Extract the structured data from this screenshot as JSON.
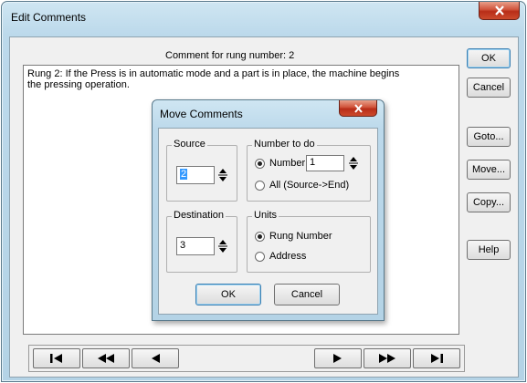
{
  "window": {
    "title": "Edit Comments",
    "rung_label": "Comment for rung number: 2",
    "comment_text": "Rung 2: If the Press is in automatic mode and a part is in place, the machine begins\nthe pressing operation.",
    "buttons": {
      "ok": "OK",
      "cancel": "Cancel",
      "goto": "Goto...",
      "move": "Move...",
      "copy": "Copy...",
      "help": "Help"
    },
    "nav_icons": [
      "first-icon",
      "rewind-icon",
      "previous-icon",
      "next-icon",
      "fast-forward-icon",
      "last-icon"
    ]
  },
  "move_dialog": {
    "title": "Move Comments",
    "source": {
      "label": "Source",
      "value": "2"
    },
    "number_to_do": {
      "label": "Number to do",
      "number_option": "Number",
      "number_value": "1",
      "all_option": "All (Source->End)",
      "selected": "number"
    },
    "destination": {
      "label": "Destination",
      "value": "3"
    },
    "units": {
      "label": "Units",
      "rung_option": "Rung Number",
      "address_option": "Address",
      "selected": "rung"
    },
    "ok": "OK",
    "cancel": "Cancel"
  },
  "colors": {
    "frame": "#bcd9eb",
    "close_button": "#c94a2e",
    "selection": "#3399ff"
  }
}
